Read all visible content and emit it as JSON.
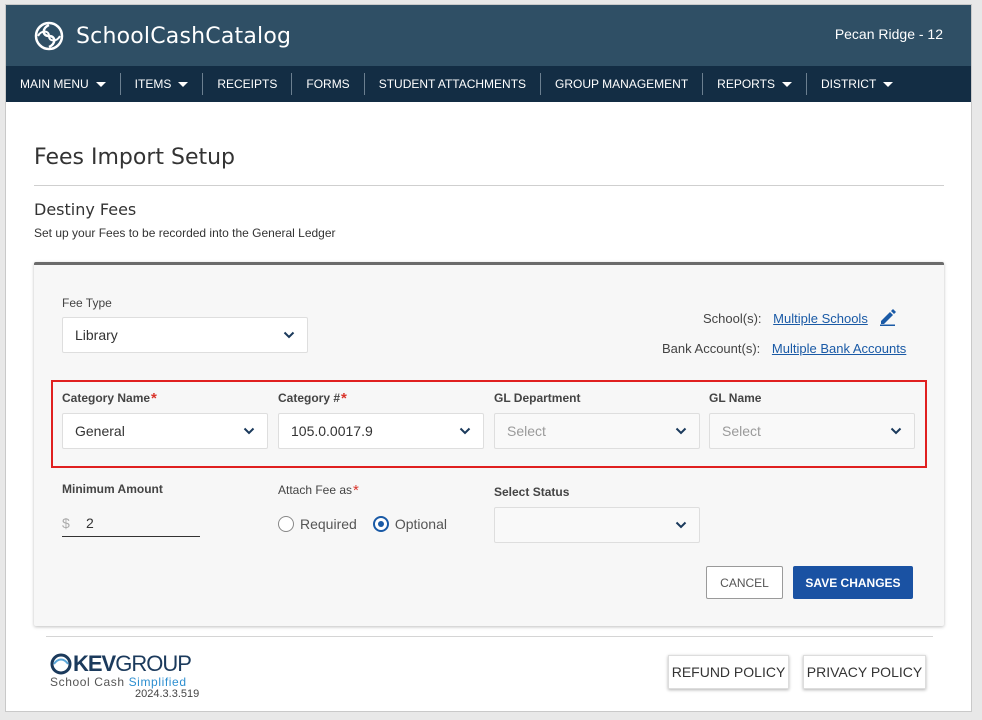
{
  "app": {
    "title": "SchoolCashCatalog",
    "school": "Pecan Ridge - 12"
  },
  "nav": {
    "items": [
      {
        "label": "MAIN MENU",
        "caret": true
      },
      {
        "label": "ITEMS",
        "caret": true
      },
      {
        "label": "RECEIPTS",
        "caret": false
      },
      {
        "label": "FORMS",
        "caret": false
      },
      {
        "label": "STUDENT ATTACHMENTS",
        "caret": false
      },
      {
        "label": "GROUP MANAGEMENT",
        "caret": false
      },
      {
        "label": "REPORTS",
        "caret": true
      },
      {
        "label": "DISTRICT",
        "caret": true
      }
    ]
  },
  "page": {
    "title": "Fees Import Setup",
    "section_title": "Destiny Fees",
    "section_sub": "Set up your Fees to be recorded into the General Ledger"
  },
  "form": {
    "fee_type_label": "Fee Type",
    "fee_type_value": "Library",
    "schools_label": "School(s):",
    "schools_link": "Multiple Schools",
    "bank_label": "Bank Account(s):",
    "bank_link": "Multiple Bank Accounts",
    "category_name_label": "Category Name",
    "category_name_value": "General",
    "category_num_label": "Category #",
    "category_num_value": "105.0.0017.9",
    "gl_department_label": "GL Department",
    "gl_department_placeholder": "Select",
    "gl_name_label": "GL Name",
    "gl_name_placeholder": "Select",
    "min_amount_label": "Minimum Amount",
    "currency_symbol": "$",
    "min_amount_value": "2",
    "attach_label": "Attach Fee as",
    "required_star": "*",
    "radio_required": "Required",
    "radio_optional": "Optional",
    "selected_radio": "Optional",
    "status_label": "Select Status",
    "status_value": "",
    "cancel_label": "CANCEL",
    "save_label": "SAVE CHANGES"
  },
  "footer": {
    "logo_kev": "KEV",
    "logo_group": "GROUP",
    "tagline_main": "School Cash",
    "tagline_accent": "Simplified",
    "version": "2024.3.3.519",
    "refund_label": "REFUND POLICY",
    "privacy_label": "PRIVACY POLICY"
  },
  "colors": {
    "header": "#2f4f65",
    "nav": "#132d44",
    "primary": "#1a52a3",
    "highlight": "#e02020",
    "required": "#d9342b"
  },
  "icons": [
    "swirl-logo-icon",
    "chevron-down-icon",
    "pencil-icon",
    "kevgroup-logo-icon"
  ]
}
